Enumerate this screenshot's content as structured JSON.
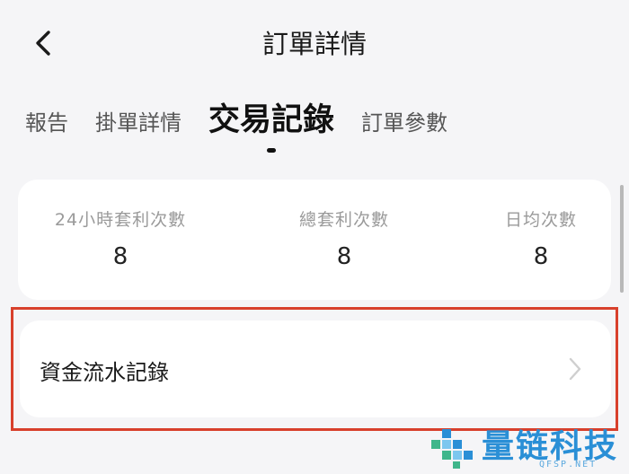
{
  "header": {
    "title": "訂單詳情",
    "back_icon": "chevron-left-icon"
  },
  "tabs": [
    {
      "label": "報告",
      "active": false
    },
    {
      "label": "掛單詳情",
      "active": false
    },
    {
      "label": "交易記錄",
      "active": true
    },
    {
      "label": "訂單參數",
      "active": false
    }
  ],
  "stats": [
    {
      "label": "24小時套利次數",
      "value": "8"
    },
    {
      "label": "總套利次數",
      "value": "8"
    },
    {
      "label": "日均次數",
      "value": "8"
    }
  ],
  "fund_record": {
    "label": "資金流水記錄",
    "icon": "chevron-right-icon"
  },
  "watermark": {
    "text": "量链科技",
    "sub": "QFSP.NET"
  },
  "colors": {
    "background": "#f5f5f7",
    "card": "#ffffff",
    "highlight": "#d8402c",
    "watermark": "#2a8fd6"
  }
}
